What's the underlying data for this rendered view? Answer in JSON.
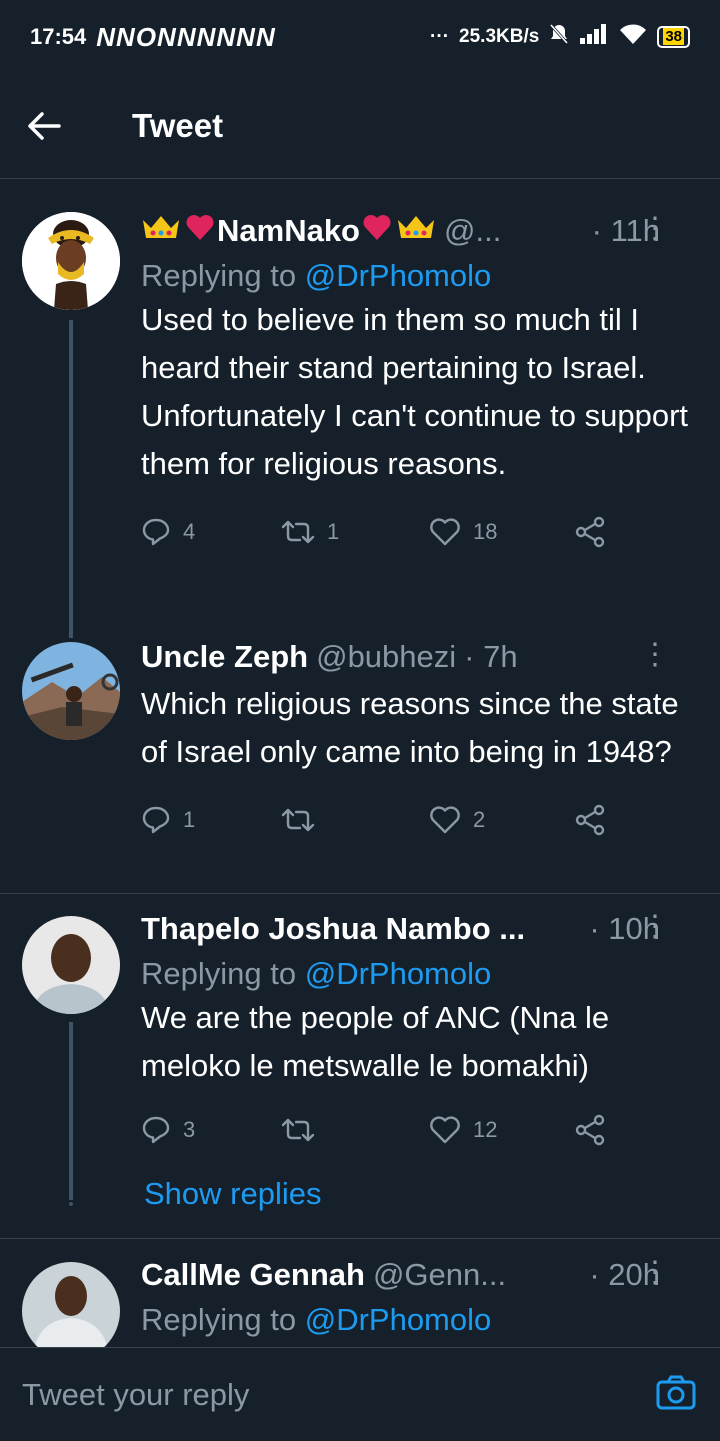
{
  "status": {
    "time": "17:54",
    "notif_icons": "NNONNNNNN",
    "dots": "···",
    "speed": "25.3KB/s",
    "battery": "38"
  },
  "header": {
    "title": "Tweet"
  },
  "tweets": [
    {
      "name": "NamNako",
      "handle": "@...",
      "time": "· 11h",
      "replying_prefix": "Replying to ",
      "replying_to": "@DrPhomolo",
      "text": "Used to believe in them so much til I heard their stand pertaining to Israel. Unfortunately I can't continue to support them for religious reasons.",
      "replies": "4",
      "retweets": "1",
      "likes": "18"
    },
    {
      "name": "Uncle Zeph",
      "handle": "@bubhezi",
      "time": "· 7h",
      "text": "Which religious reasons since the state of Israel only came into being in 1948?",
      "replies": "1",
      "retweets": "",
      "likes": "2"
    },
    {
      "name": "Thapelo Joshua Nambo ...",
      "handle": "",
      "time": "· 10h",
      "replying_prefix": "Replying to ",
      "replying_to": "@DrPhomolo",
      "text": "We are the people of ANC (Nna le meloko le metswalle le bomakhi)",
      "replies": "3",
      "retweets": "",
      "likes": "12",
      "show_replies": "Show replies"
    },
    {
      "name": "CallMe Gennah",
      "handle": "@Genn...",
      "time": "· 20h",
      "replying_prefix": "Replying to ",
      "replying_to": "@DrPhomolo"
    }
  ],
  "reply_bar": {
    "placeholder": "Tweet your reply"
  },
  "colors": {
    "background": "#15202b",
    "accent": "#1d9bf0",
    "muted": "#8b98a5",
    "heart": "#e0245e",
    "crown": "#f5c518"
  }
}
